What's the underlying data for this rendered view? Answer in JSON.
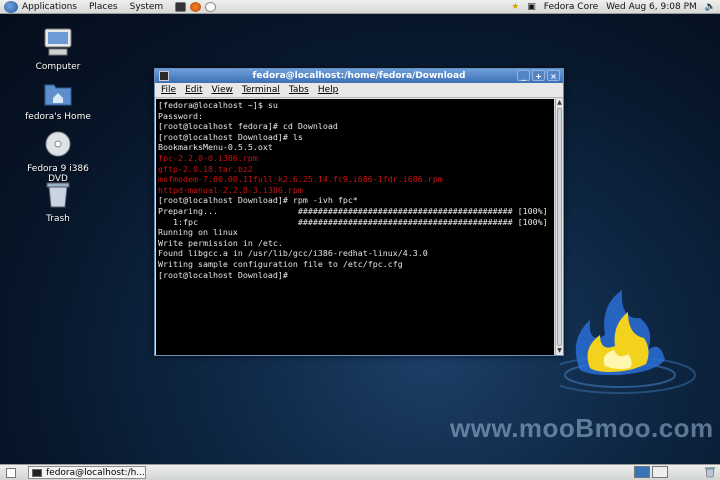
{
  "top_panel": {
    "menus": [
      "Applications",
      "Places",
      "System"
    ],
    "host_label": "Fedora Core",
    "datetime": "Wed Aug  6,  9:08 PM"
  },
  "desktop_icons": [
    {
      "label": "Computer"
    },
    {
      "label": "fedora's Home"
    },
    {
      "label": "Fedora 9 i386 DVD"
    },
    {
      "label": "Trash"
    }
  ],
  "window": {
    "title": "fedora@localhost:/home/fedora/Download",
    "menu": [
      "File",
      "Edit",
      "View",
      "Terminal",
      "Tabs",
      "Help"
    ],
    "lines": [
      "[fedora@localhost ~]$ su",
      "Password:",
      "[root@localhost fedora]# cd Download",
      "[root@localhost Download]# ls",
      "BookmarksMenu-0.5.5.oxt",
      "fpc-2.2.0-0.i386.rpm",
      "gftp-2.0.18.tar.bz2",
      "msfmodem-7.80.00.11full_k2.6.25.14.fc9.i686-1fdr.i686.rpm",
      "httpd-manual-2.2.8-3.i386.rpm",
      "[root@localhost Download]# rpm -ivh fpc*",
      "Preparing...                ########################################### [100%]",
      "   1:fpc                    ########################################### [100%]",
      "Running on linux",
      "Write permission in /etc.",
      "Found libgcc.a in /usr/lib/gcc/i386-redhat-linux/4.3.0",
      "Writing sample configuration file to /etc/fpc.cfg",
      "[root@localhost Download]#"
    ],
    "red_line_indices": [
      5,
      6,
      7,
      8
    ]
  },
  "watermark": "www.mooBmoo.com",
  "bottom_panel": {
    "task_label": "fedora@localhost:/h..."
  },
  "colors": {
    "titlebar": "#3c6fb3",
    "terminal_bg": "#000000",
    "terminal_fg": "#e6e6e6",
    "filename_red": "#cc1111",
    "flame_yellow": "#f2d21c"
  }
}
